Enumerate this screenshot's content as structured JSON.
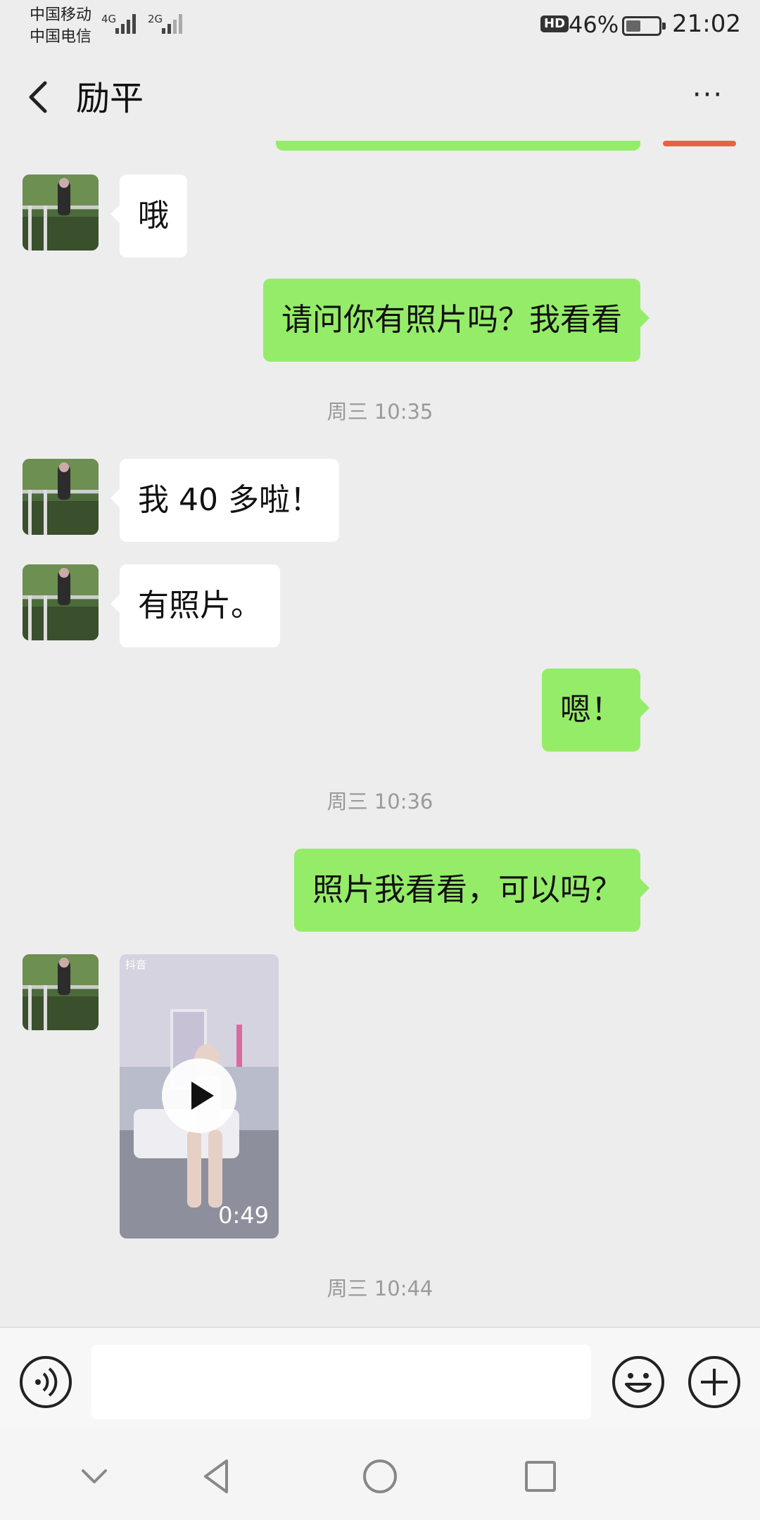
{
  "status_bar": {
    "carrier_1": "中国移动",
    "carrier_2": "中国电信",
    "network_1": "4G",
    "network_2": "2G",
    "hd": "HD",
    "battery_percent": "46%",
    "battery_level": 0.46,
    "time": "21:02"
  },
  "header": {
    "back_icon": "chevron-left-icon",
    "title": "励平",
    "more_icon": "more-dots-icon",
    "more_label": "···"
  },
  "messages": [
    {
      "type": "in",
      "text": "哦"
    },
    {
      "type": "out",
      "text": "请问你有照片吗？我看看"
    },
    {
      "type": "time",
      "text": "周三 10:35"
    },
    {
      "type": "in",
      "text": "我 40 多啦！"
    },
    {
      "type": "in",
      "text": "有照片。"
    },
    {
      "type": "out",
      "text": "嗯！"
    },
    {
      "type": "time",
      "text": "周三 10:36"
    },
    {
      "type": "out",
      "text": "照片我看看，可以吗？"
    },
    {
      "type": "video",
      "app_label": "抖音",
      "duration": "0:49"
    },
    {
      "type": "time",
      "text": "周三 10:44"
    }
  ],
  "input_bar": {
    "voice_icon": "voice-icon",
    "text_value": "",
    "emoji_icon": "emoji-icon",
    "plus_icon": "plus-icon"
  },
  "system_nav": {
    "icons": [
      "hide-keyboard-icon",
      "back-triangle-icon",
      "home-circle-icon",
      "recents-square-icon"
    ]
  },
  "colors": {
    "background": "#ededed",
    "outgoing_bubble": "#95ec69",
    "incoming_bubble": "#ffffff",
    "timestamp": "#9a9a9a"
  }
}
